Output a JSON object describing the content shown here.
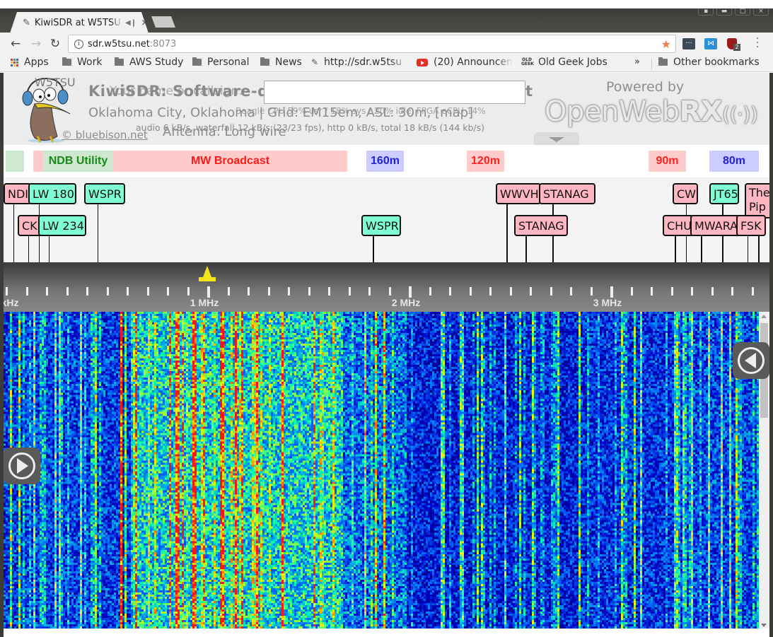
{
  "browser": {
    "tab_title": "KiwiSDR at W5TSU",
    "tab_audio_icon": "speaker-icon",
    "tab_close": "×",
    "address": {
      "host": "sdr.w5tsu.net",
      "port": ":8073"
    },
    "extensions": [
      "lastpass-icon",
      "remote-desktop-icon",
      "ublock-icon"
    ],
    "ublock_badge": "2",
    "bookmarks": [
      {
        "label": "Apps",
        "icon": "apps-icon"
      },
      {
        "label": "Work",
        "icon": "folder-icon"
      },
      {
        "label": "AWS Study",
        "icon": "folder-icon"
      },
      {
        "label": "Personal",
        "icon": "folder-icon"
      },
      {
        "label": "News",
        "icon": "folder-icon"
      },
      {
        "label": "http://sdr.w5tsu",
        "icon": "kiwi-icon"
      },
      {
        "label": "(20) Announcem",
        "icon": "youtube-icon"
      },
      {
        "label": "Old Geek Jobs",
        "icon": "oldgeek-icon"
      }
    ],
    "bookmarks_overflow": "»",
    "other_bookmarks": "Other bookmarks"
  },
  "header": {
    "callsign": "W5TSU",
    "title": "KiwiSDR: Software-d",
    "title_overlap": "Your name or callsign:",
    "title_tail": "t",
    "name_input_value": "",
    "location": "Oklahoma City, Oklahoma | Grid: ",
    "grid": "EM15em",
    "asl": ", ASL: 30m, ",
    "map_link": "[map]",
    "cpu_stats": "Beagle CPU 59% usr / 18% sys / 20% idle, FPGA eCPU 14%",
    "net_stats": "audio 6 kB/s, waterfall 12 kB/s (23/23 fps), http 0 kB/s, total 18 kB/s (144 kb/s)",
    "antenna": "Antenna: Long wire",
    "credit": "© bluebison.net",
    "powered_by": "Powered by",
    "owrx_light": "OpenWeb",
    "owrx_bold": "RX",
    "owrx_waves": "((·))"
  },
  "bands": [
    {
      "label": "",
      "bg": "#cfe8d2",
      "fg": "#1a8a1a"
    },
    {
      "label": "",
      "bg": "#ffcccc",
      "fg": "#ff2020"
    },
    {
      "label": "NDB Utility",
      "bg": "#cde8cf",
      "fg": "#1a8a1a"
    },
    {
      "label": "MW Broadcast",
      "bg": "#ffcccc",
      "fg": "#ff1a1a"
    },
    {
      "label": "160m",
      "bg": "#ccccff",
      "fg": "#2222dd"
    },
    {
      "label": "120m",
      "bg": "#ffcccc",
      "fg": "#ff2020"
    },
    {
      "label": "90m",
      "bg": "#ffcccc",
      "fg": "#ff2020"
    },
    {
      "label": "80m",
      "bg": "#ccccff",
      "fg": "#2222dd"
    }
  ],
  "dx_labels": [
    {
      "label": "NDI",
      "type": "pink"
    },
    {
      "label": "LW 180",
      "type": "green"
    },
    {
      "label": "WSPR",
      "type": "green"
    },
    {
      "label": "CKI",
      "type": "pink"
    },
    {
      "label": "LW 234",
      "type": "green"
    },
    {
      "label": "WSPR",
      "type": "green"
    },
    {
      "label": "WWVH",
      "type": "pink"
    },
    {
      "label": "STANAG",
      "type": "pink"
    },
    {
      "label": "STANAG",
      "type": "pink"
    },
    {
      "label": "CW",
      "type": "pink"
    },
    {
      "label": "JT65",
      "type": "green"
    },
    {
      "label": "The Pip",
      "type": "pink"
    },
    {
      "label": "CHU",
      "type": "pink"
    },
    {
      "label": "MWARA",
      "type": "pink"
    },
    {
      "label": "FSK",
      "type": "pink"
    }
  ],
  "scale": {
    "labels": [
      "kHz",
      "1 MHz",
      "2 MHz",
      "3 MHz"
    ],
    "tuned_frequency_marker": "passband-icon"
  },
  "controls": {
    "left_button": "play-icon",
    "right_button": "back-arrow-icon"
  }
}
